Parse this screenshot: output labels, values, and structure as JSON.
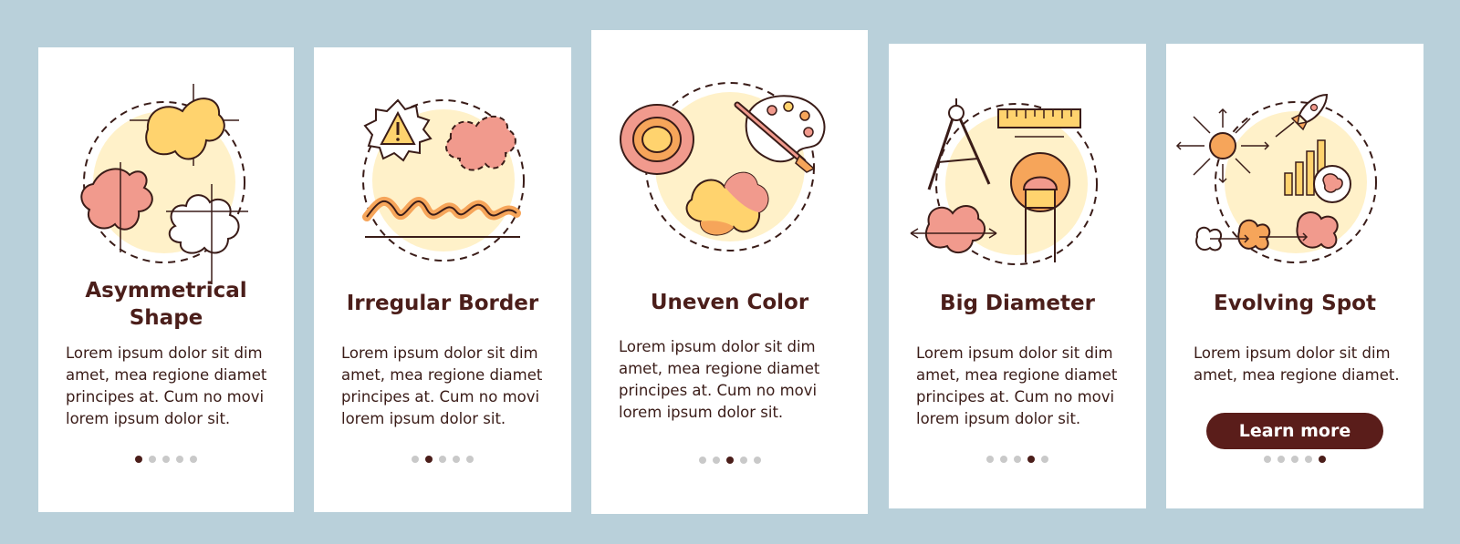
{
  "colors": {
    "background": "#b9d0da",
    "card": "#ffffff",
    "title": "#4b1e1a",
    "accent_pink": "#f19a8d",
    "accent_yellow": "#ffd36e",
    "accent_cream": "#fff1c9",
    "accent_orange": "#f6a55a",
    "button": "#5a1d1a"
  },
  "cards": [
    {
      "title": "Asymmetrical Shape",
      "text": "Lorem ipsum dolor sit dim amet, mea regione diamet principes at. Cum no movi lorem ipsum dolor sit.",
      "icon": "asymmetrical-shapes-icon",
      "active_step": 1
    },
    {
      "title": "Irregular Border",
      "text": "Lorem ipsum dolor sit dim amet, mea regione diamet principes at. Cum no movi lorem ipsum dolor sit.",
      "icon": "irregular-border-warning-icon",
      "active_step": 2
    },
    {
      "title": "Uneven Color",
      "text": "Lorem ipsum dolor sit dim amet, mea regione diamet principes at. Cum no movi lorem ipsum dolor sit.",
      "icon": "palette-brush-icon",
      "active_step": 3
    },
    {
      "title": "Big Diameter",
      "text": "Lorem ipsum dolor sit dim amet, mea regione diamet principes at. Cum no movi lorem ipsum dolor sit.",
      "icon": "compass-ruler-icon",
      "active_step": 4
    },
    {
      "title": "Evolving Spot",
      "text": "Lorem ipsum dolor sit dim amet, mea regione diamet.",
      "icon": "evolving-spot-rocket-icon",
      "active_step": 5,
      "button_label": "Learn more"
    }
  ],
  "pagination": {
    "total": 5
  }
}
